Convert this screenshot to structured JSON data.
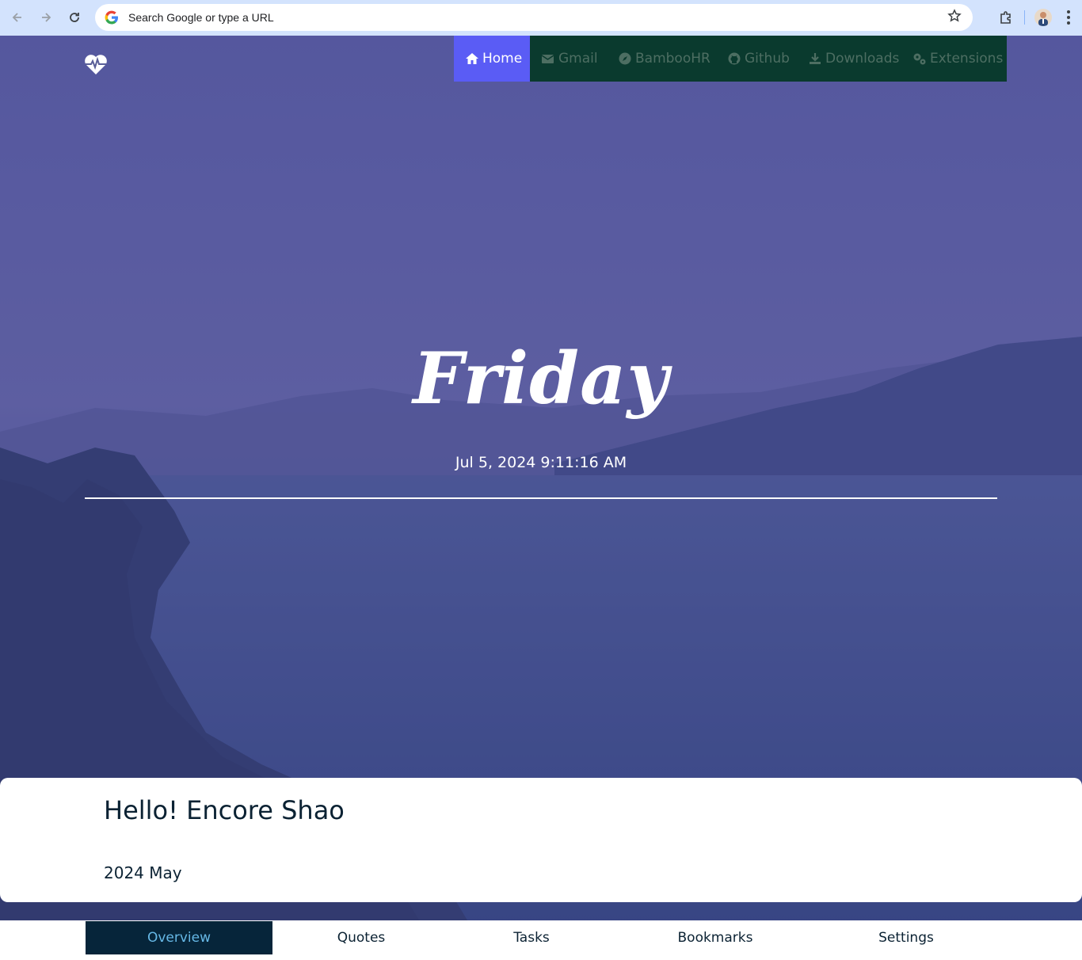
{
  "browser": {
    "omnibox_placeholder": "Search Google or type a URL"
  },
  "topnav": {
    "items": [
      {
        "label": "Home",
        "icon": "home-icon"
      },
      {
        "label": "Gmail",
        "icon": "mail-icon"
      },
      {
        "label": "BambooHR",
        "icon": "compass-icon"
      },
      {
        "label": "Github",
        "icon": "github-icon"
      },
      {
        "label": "Downloads",
        "icon": "download-icon"
      },
      {
        "label": "Extensions",
        "icon": "gears-icon"
      }
    ],
    "active_color": "#5a5cf5",
    "bg_color": "#0a3a2e"
  },
  "hero": {
    "day": "Friday",
    "datetime": "Jul 5, 2024 9:11:16 AM"
  },
  "welcome": {
    "greeting": "Hello! Encore Shao",
    "month": "2024 May"
  },
  "tabs": [
    {
      "label": "Overview",
      "active": true
    },
    {
      "label": "Quotes"
    },
    {
      "label": "Tasks"
    },
    {
      "label": "Bookmarks"
    },
    {
      "label": "Settings"
    }
  ]
}
